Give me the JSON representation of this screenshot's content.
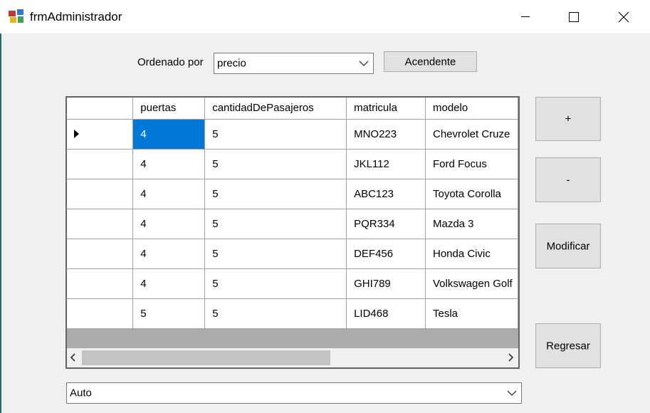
{
  "window": {
    "title": "frmAdministrador"
  },
  "sort": {
    "label": "Ordenado por",
    "field_value": "precio",
    "direction_button": "Acendente"
  },
  "grid": {
    "columns": [
      "puertas",
      "cantidadDePasajeros",
      "matricula",
      "modelo"
    ],
    "rows": [
      [
        "4",
        "5",
        "MNO223",
        "Chevrolet Cruze"
      ],
      [
        "4",
        "5",
        "JKL112",
        "Ford Focus"
      ],
      [
        "4",
        "5",
        "ABC123",
        "Toyota Corolla"
      ],
      [
        "4",
        "5",
        "PQR334",
        "Mazda 3"
      ],
      [
        "4",
        "5",
        "DEF456",
        "Honda Civic"
      ],
      [
        "4",
        "5",
        "GHI789",
        "Volkswagen Golf"
      ],
      [
        "5",
        "5",
        "LID468",
        "Tesla"
      ]
    ]
  },
  "buttons": {
    "add": "+",
    "remove": "-",
    "modify": "Modificar",
    "back": "Regresar"
  },
  "vehicle_type": {
    "value": "Auto"
  },
  "colors": {
    "selection": "#0078d7",
    "grid_background": "#ababab"
  }
}
